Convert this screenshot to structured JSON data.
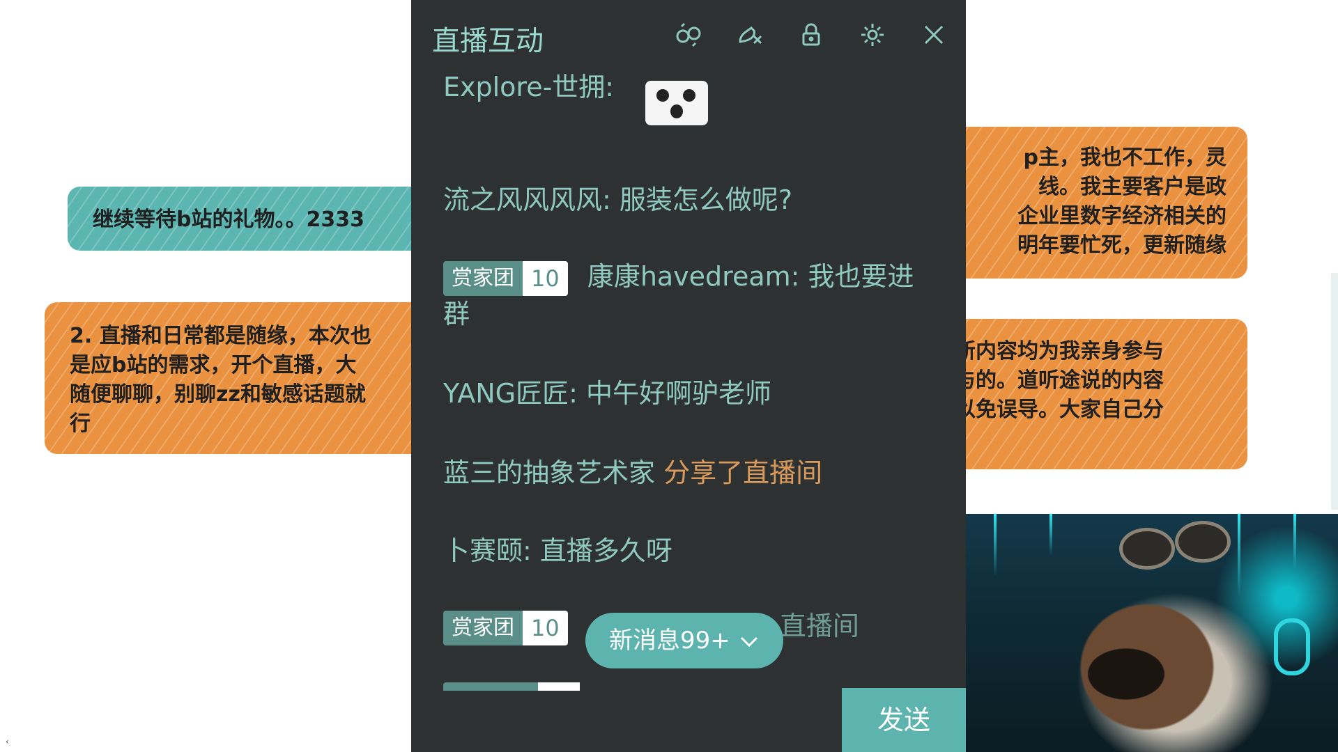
{
  "slide": {
    "top_faint_text": "",
    "note_teal_left": "继续等待b站的礼物。。2333",
    "note_orange_left": [
      "2. 直播和日常都是随缘，本次也",
      "是应b站的需求，开个直播，大",
      "随便聊聊，别聊zz和敏感话题就",
      "行"
    ],
    "note_orange_right_1": [
      "p主，我也不工作，灵",
      "线。我主要客户是政",
      "企业里数字经济相关的",
      "明年要忙死，更新随缘"
    ],
    "note_orange_right_2": [
      "新内容均为我亲身参与",
      "与的。道听途说的内容",
      "以免误导。大家自己分"
    ]
  },
  "chat_panel": {
    "title": "直播互动",
    "header_icons": [
      "effects-icon",
      "block-user-icon",
      "lock-icon",
      "settings-icon",
      "close-icon"
    ],
    "messages": [
      {
        "user": "Explore-世拥:",
        "text": ""
      },
      {
        "user": "流之风风风风:",
        "text": "服装怎么做呢?"
      },
      {
        "badge_name": "赏家团",
        "badge_level": "10",
        "user": "康康havedream:",
        "text": "我也要进",
        "text2": "群"
      },
      {
        "user": "YANG匠匠:",
        "text": "中午好啊驴老师"
      },
      {
        "user": "蓝三的抽象艺术家",
        "share": "分享了直播间"
      },
      {
        "user": "卜赛颐:",
        "text": "直播多久呀"
      },
      {
        "badge_name": "赏家团",
        "badge_level": "10",
        "partial": "直播间"
      }
    ],
    "new_messages_label": "新消息99+",
    "send_label": "发送"
  }
}
